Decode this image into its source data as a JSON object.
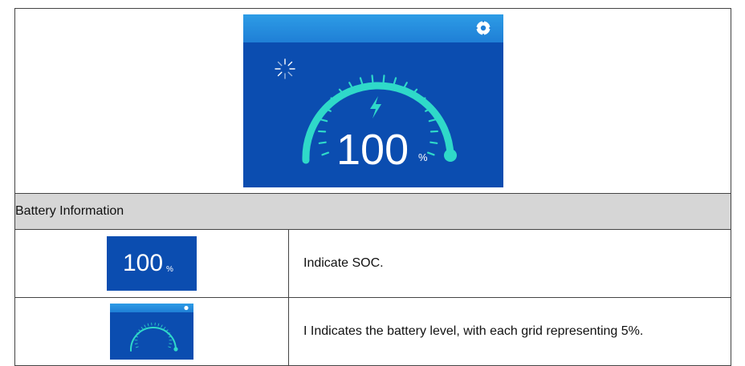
{
  "screen": {
    "soc_value": "100",
    "soc_unit": "%",
    "gear_icon": "gear-icon",
    "loading_icon": "loading-spinner-icon",
    "charge_icon": "lightning-icon",
    "gauge_level_percent": 100,
    "grid_step_percent": 5
  },
  "table": {
    "section_header": "Battery Information",
    "rows": [
      {
        "icon": "soc-display",
        "soc_value": "100",
        "soc_unit": "%",
        "description": "Indicate SOC."
      },
      {
        "icon": "battery-gauge",
        "description": "I Indicates the battery level, with each grid representing 5%."
      }
    ]
  },
  "colors": {
    "screen_background": "#0b4db0",
    "top_bar": "#2d9ce6",
    "gauge_arc": "#2fd9c9",
    "header_row": "#d6d6d6"
  }
}
